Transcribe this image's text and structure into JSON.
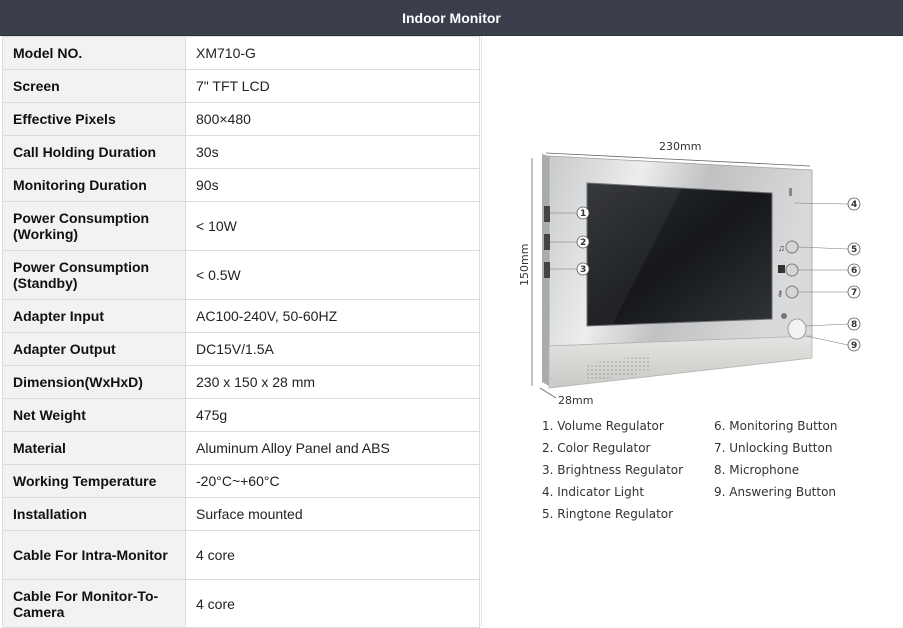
{
  "header": {
    "title": "Indoor Monitor"
  },
  "specs": [
    {
      "label": "Model NO.",
      "value": "XM710-G"
    },
    {
      "label": "Screen",
      "value": "7\" TFT LCD"
    },
    {
      "label": "Effective Pixels",
      "value": "800×480"
    },
    {
      "label": "Call Holding Duration",
      "value": "30s"
    },
    {
      "label": "Monitoring Duration",
      "value": "90s"
    },
    {
      "label": "Power Consumption (Working)",
      "value": "< 10W"
    },
    {
      "label": "Power Consumption (Standby)",
      "value": "< 0.5W"
    },
    {
      "label": "Adapter Input",
      "value": "AC100-240V, 50-60HZ"
    },
    {
      "label": "Adapter Output",
      "value": "DC15V/1.5A"
    },
    {
      "label": "Dimension(WxHxD)",
      "value": "230 x 150 x 28 mm"
    },
    {
      "label": "Net Weight",
      "value": "475g"
    },
    {
      "label": "Material",
      "value": "Aluminum Alloy Panel and ABS"
    },
    {
      "label": "Working Temperature",
      "value": "-20°C~+60°C"
    },
    {
      "label": "Installation",
      "value": "Surface mounted"
    },
    {
      "label": "Cable For Intra-Monitor",
      "value": "4 core"
    },
    {
      "label": "Cable For Monitor-To-Camera",
      "value": "4 core"
    }
  ],
  "diagram": {
    "width_label": "230mm",
    "height_label": "150mm",
    "depth_label": "28mm",
    "callouts": [
      "1",
      "2",
      "3",
      "4",
      "5",
      "6",
      "7",
      "8",
      "9"
    ]
  },
  "legend": {
    "col1": [
      "1. Volume Regulator",
      "2. Color Regulator",
      "3. Brightness Regulator",
      "4. Indicator Light",
      "5. Ringtone Regulator"
    ],
    "col2": [
      "6. Monitoring Button",
      "7. Unlocking Button",
      "8. Microphone",
      "9. Answering Button"
    ]
  }
}
